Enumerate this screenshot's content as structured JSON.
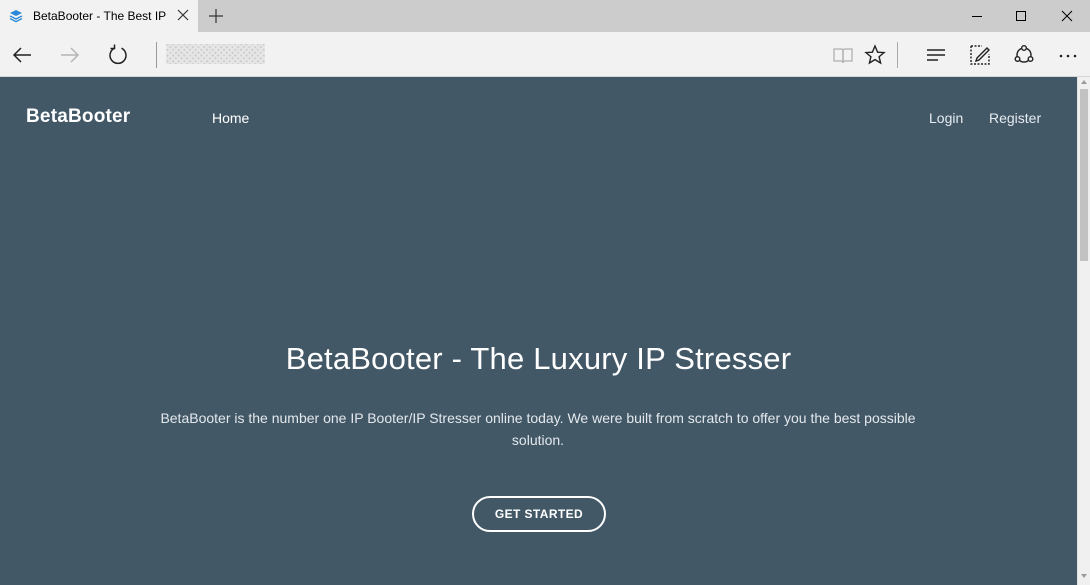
{
  "browser": {
    "tab_title": "BetaBooter - The Best IP Stresser",
    "tab_icon": "layers-icon",
    "address_bar_obscured": true
  },
  "site": {
    "brand": "BetaBooter",
    "nav": {
      "home": "Home",
      "login": "Login",
      "register": "Register"
    },
    "hero": {
      "title": "BetaBooter - The Luxury IP Stresser",
      "text": "BetaBooter is the number one IP Booter/IP Stresser online today. We were built from scratch to offer you the best possible solution.",
      "cta": "GET STARTED"
    }
  },
  "colors": {
    "page_background": "#435867",
    "chrome_titlebar": "#cccccc",
    "chrome_toolbar": "#f2f2f2",
    "tab_icon_blue": "#2b88d8"
  }
}
